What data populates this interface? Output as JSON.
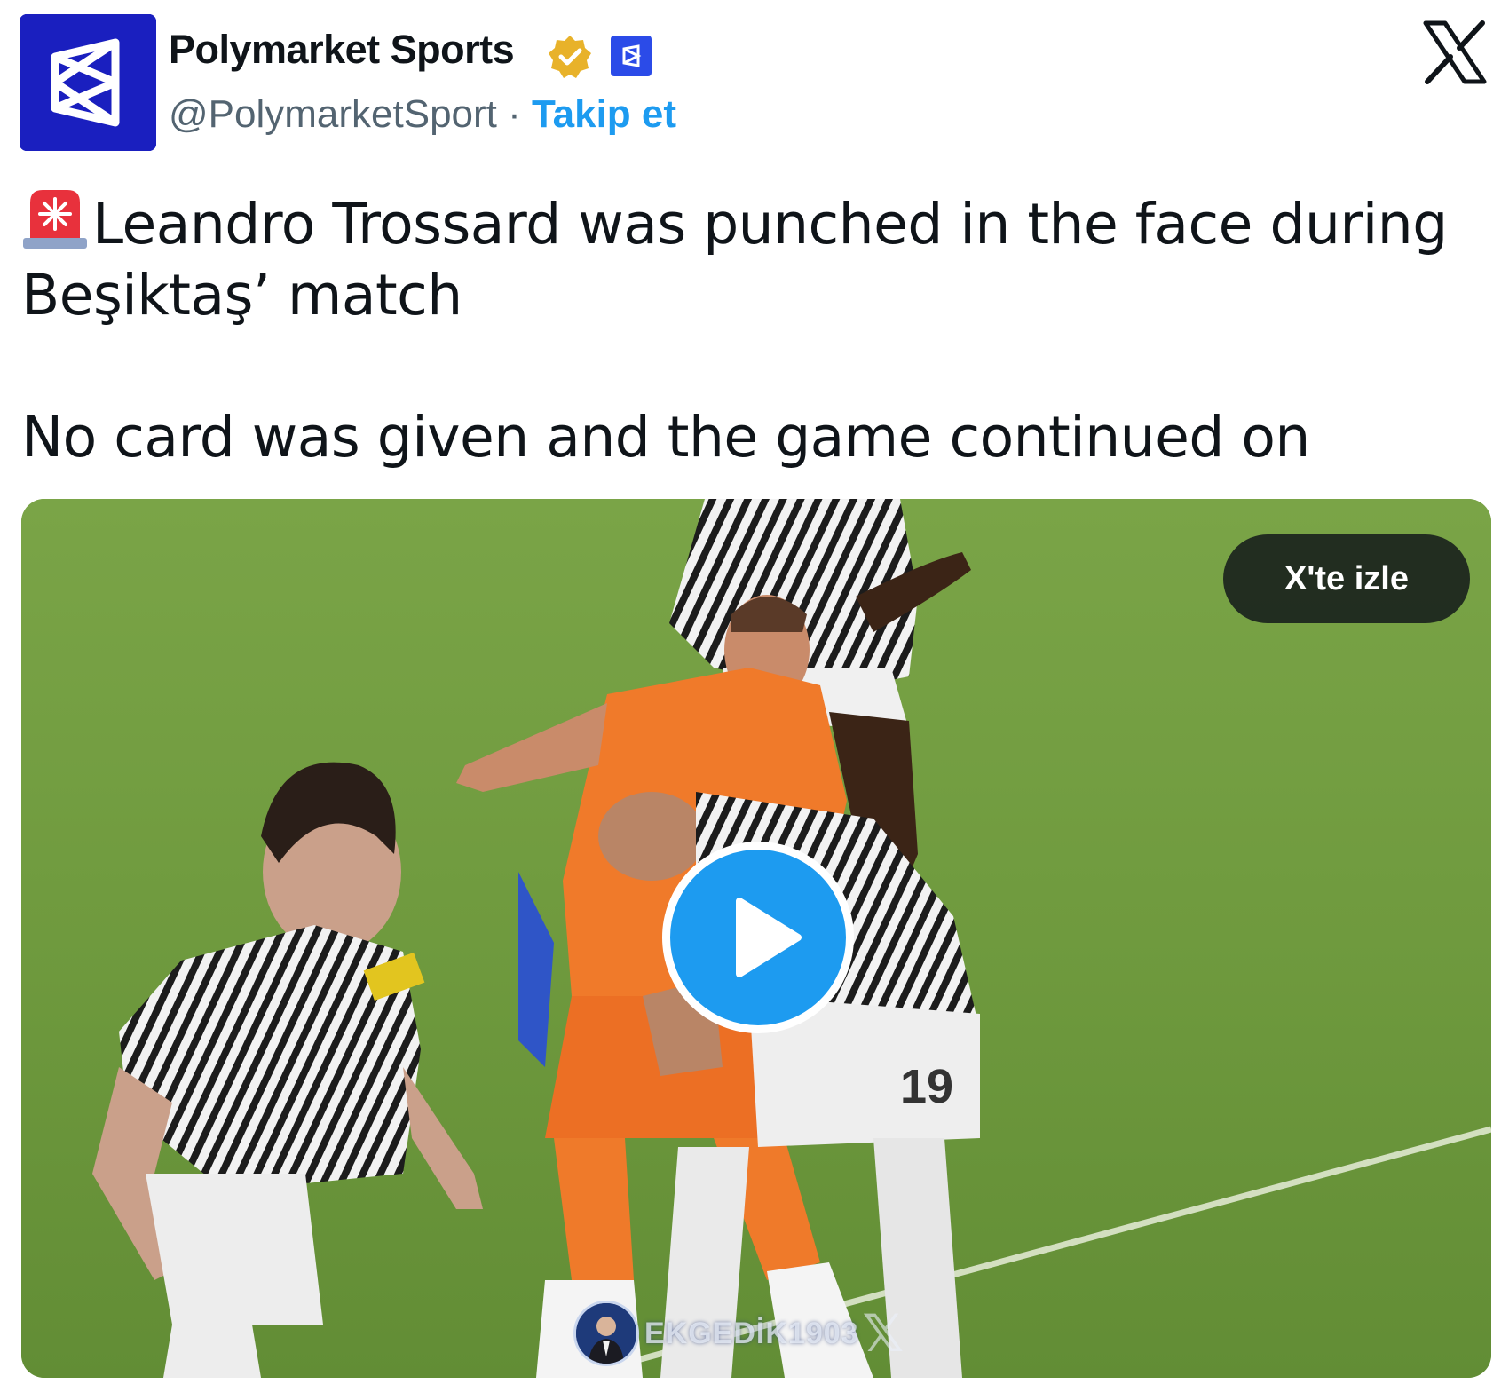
{
  "author": {
    "name": "Polymarket Sports",
    "handle": "@PolymarketSport",
    "separator": " · ",
    "follow_label": "Takip et",
    "verified_icon": "verified-gold-badge-icon",
    "affiliate_icon": "affiliate-badge-icon"
  },
  "platform_icon": "x-logo-icon",
  "tweet": {
    "emoji": "rotating-light-siren-icon",
    "line1": "Leandro Trossard was punched in the face during Beşiktaş’ match",
    "line2": "No card was given and the game continued on"
  },
  "media": {
    "watch_label": "X'te izle",
    "play_icon": "play-icon",
    "watermark": "EKGEDİK1903",
    "jersey_number": "19"
  },
  "colors": {
    "brand_blue": "#1d9bf0",
    "avatar_bg": "#1a1fbf",
    "verified_gold": "#e8b22a",
    "pitch_green": "#6f9a3e"
  }
}
